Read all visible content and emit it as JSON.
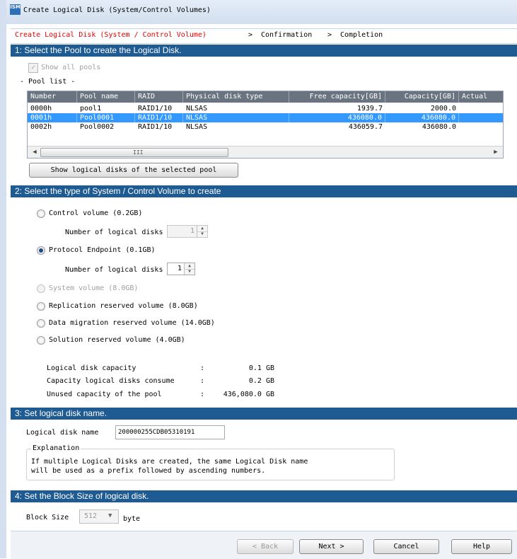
{
  "window": {
    "title": "Create Logical Disk (System/Control Volumes)",
    "icon_name": "ism-app-icon",
    "icon_text": "ISM"
  },
  "breadcrumb": {
    "step1": "Create Logical Disk (System / Control Volume)",
    "sep1": ">",
    "step2": "Confirmation",
    "sep2": ">",
    "step3": "Completion",
    "active_color": "#e00000"
  },
  "section1": {
    "header": "1: Select the Pool to create the Logical Disk.",
    "show_all_label": "Show all pools",
    "show_all_checked": true,
    "pool_list_label": "- Pool list -",
    "columns": [
      "Number",
      "Pool name",
      "RAID",
      "Physical disk type",
      "Free capacity[GB]",
      "Capacity[GB]",
      "Actual"
    ],
    "rows": [
      {
        "number": "0000h",
        "pool_name": "pool1",
        "raid": "RAID1/10",
        "disk_type": "NLSAS",
        "free": "1939.7",
        "capacity": "2000.0",
        "selected": false
      },
      {
        "number": "0001h",
        "pool_name": "Pool0001",
        "raid": "RAID1/10",
        "disk_type": "NLSAS",
        "free": "436080.0",
        "capacity": "436080.0",
        "selected": true
      },
      {
        "number": "0002h",
        "pool_name": "Pool0002",
        "raid": "RAID1/10",
        "disk_type": "NLSAS",
        "free": "436059.7",
        "capacity": "436080.0",
        "selected": false
      }
    ],
    "scroll_grip": "III",
    "show_disks_button": "Show logical disks of the selected pool"
  },
  "section2": {
    "header": "2: Select the type of System / Control Volume to create",
    "control_volume": "Control volume (0.2GB)",
    "control_num_label": "Number of logical disks",
    "control_num_value": "1",
    "protocol_endpoint": "Protocol Endpoint (0.1GB)",
    "pe_num_label": "Number of logical disks",
    "pe_num_value": "1",
    "system_volume": "System volume (8.0GB)",
    "replication": "Replication reserved volume (8.0GB)",
    "data_migration": "Data migration reserved volume (14.0GB)",
    "solution": "Solution reserved volume (4.0GB)",
    "selected": "protocol_endpoint",
    "summary": [
      {
        "label": "Logical disk capacity",
        "sep": ":",
        "value": "0.1 GB"
      },
      {
        "label": "Capacity logical disks consume",
        "sep": ":",
        "value": "0.2 GB"
      },
      {
        "label": "Unused capacity of the pool",
        "sep": ":",
        "value": "436,080.0 GB"
      }
    ]
  },
  "section3": {
    "header": "3: Set logical disk name.",
    "name_label": "Logical disk name",
    "name_value": "200000255CDB05310191",
    "explanation_title": "Explanation",
    "explanation_line1": "If multiple Logical Disks are created, the same Logical Disk name",
    "explanation_line2": "will be used as a prefix followed by ascending numbers."
  },
  "section4": {
    "header": "4: Set the Block Size of logical disk.",
    "block_size_label": "Block Size",
    "block_size_value": "512",
    "block_size_unit": "byte"
  },
  "footer": {
    "back": "< Back",
    "next": "Next >",
    "cancel": "Cancel",
    "help": "Help"
  },
  "colors": {
    "section_header_bg": "#1f5b93",
    "selected_row_bg": "#3399ff",
    "table_header_bg": "#6a7480"
  }
}
